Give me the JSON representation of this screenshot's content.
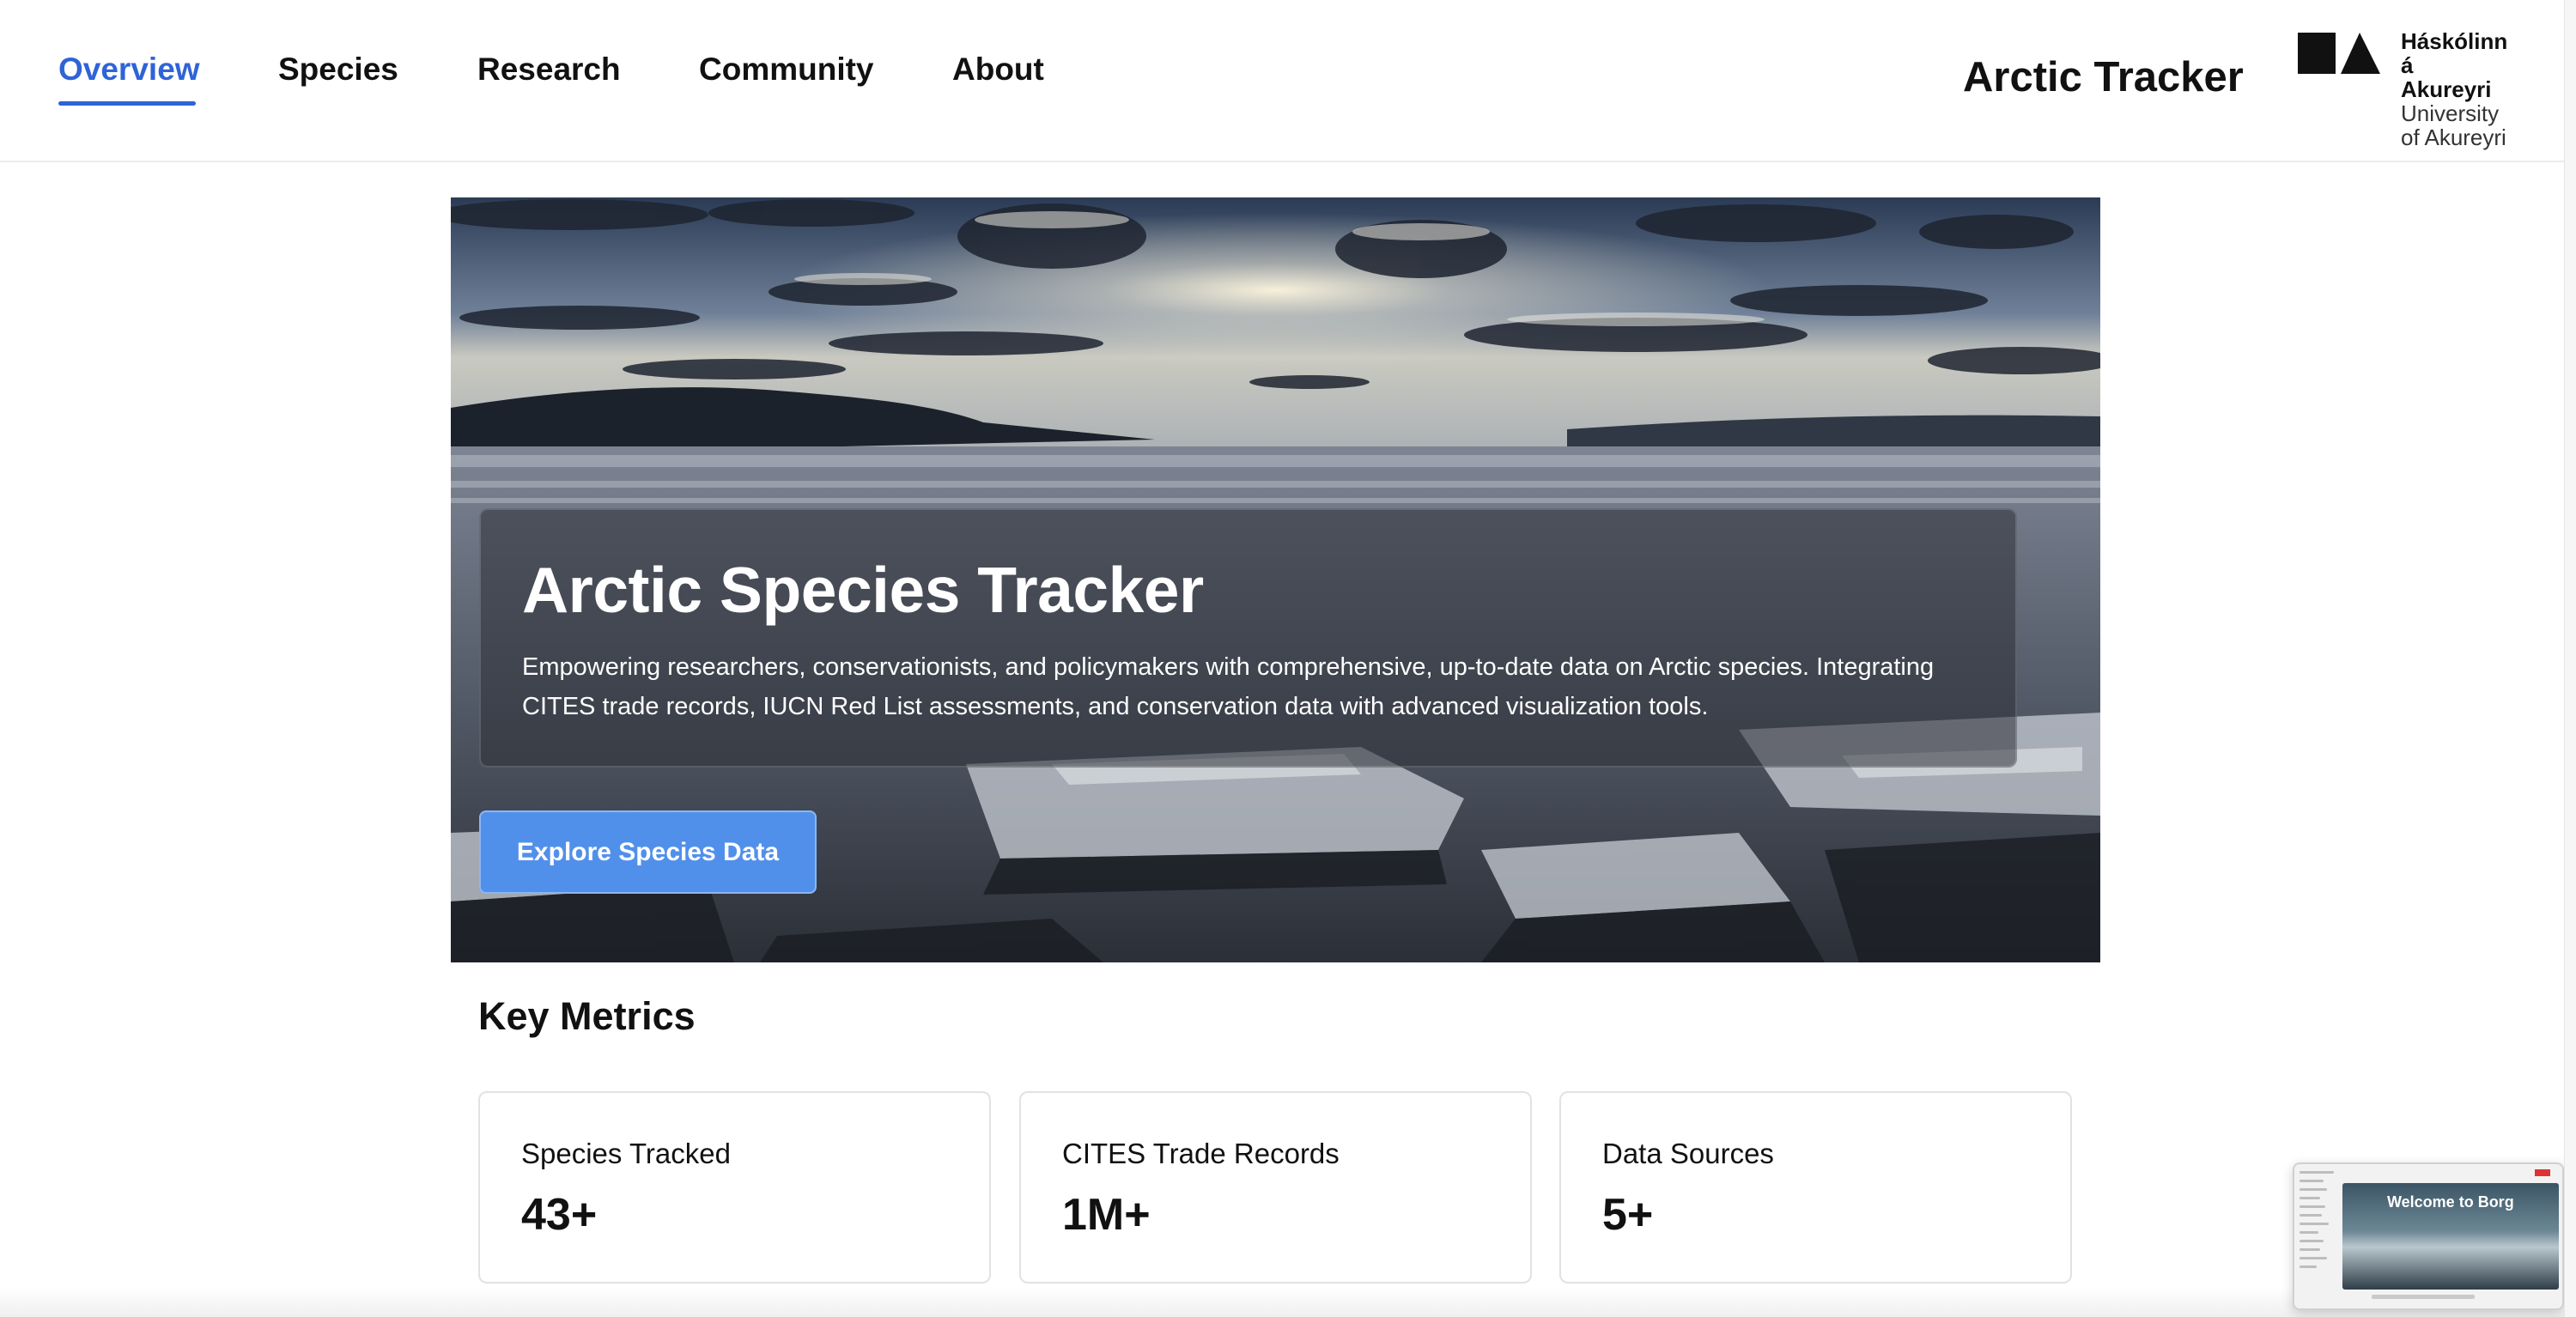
{
  "nav": {
    "items": [
      {
        "label": "Overview",
        "active": true
      },
      {
        "label": "Species",
        "active": false
      },
      {
        "label": "Research",
        "active": false
      },
      {
        "label": "Community",
        "active": false
      },
      {
        "label": "About",
        "active": false
      }
    ]
  },
  "brand": {
    "title": "Arctic Tracker",
    "university": {
      "line1": "Háskólinn",
      "line2": "á Akureyri",
      "line3": "University",
      "line4": "of Akureyri"
    }
  },
  "hero": {
    "title": "Arctic Species Tracker",
    "description": "Empowering researchers, conservationists, and policymakers with comprehensive, up-to-date data on Arctic species. Integrating CITES trade records, IUCN Red List assessments, and conservation data with advanced visualization tools.",
    "button_label": "Explore Species Data"
  },
  "metrics": {
    "title": "Key Metrics",
    "cards": [
      {
        "label": "Species Tracked",
        "value": "43+"
      },
      {
        "label": "CITES Trade Records",
        "value": "1M+"
      },
      {
        "label": "Data Sources",
        "value": "5+"
      }
    ]
  },
  "thumbnail": {
    "title": "Welcome to Borg"
  },
  "colors": {
    "accent": "#2f64d6",
    "button": "#5190ea",
    "text": "#111111"
  }
}
